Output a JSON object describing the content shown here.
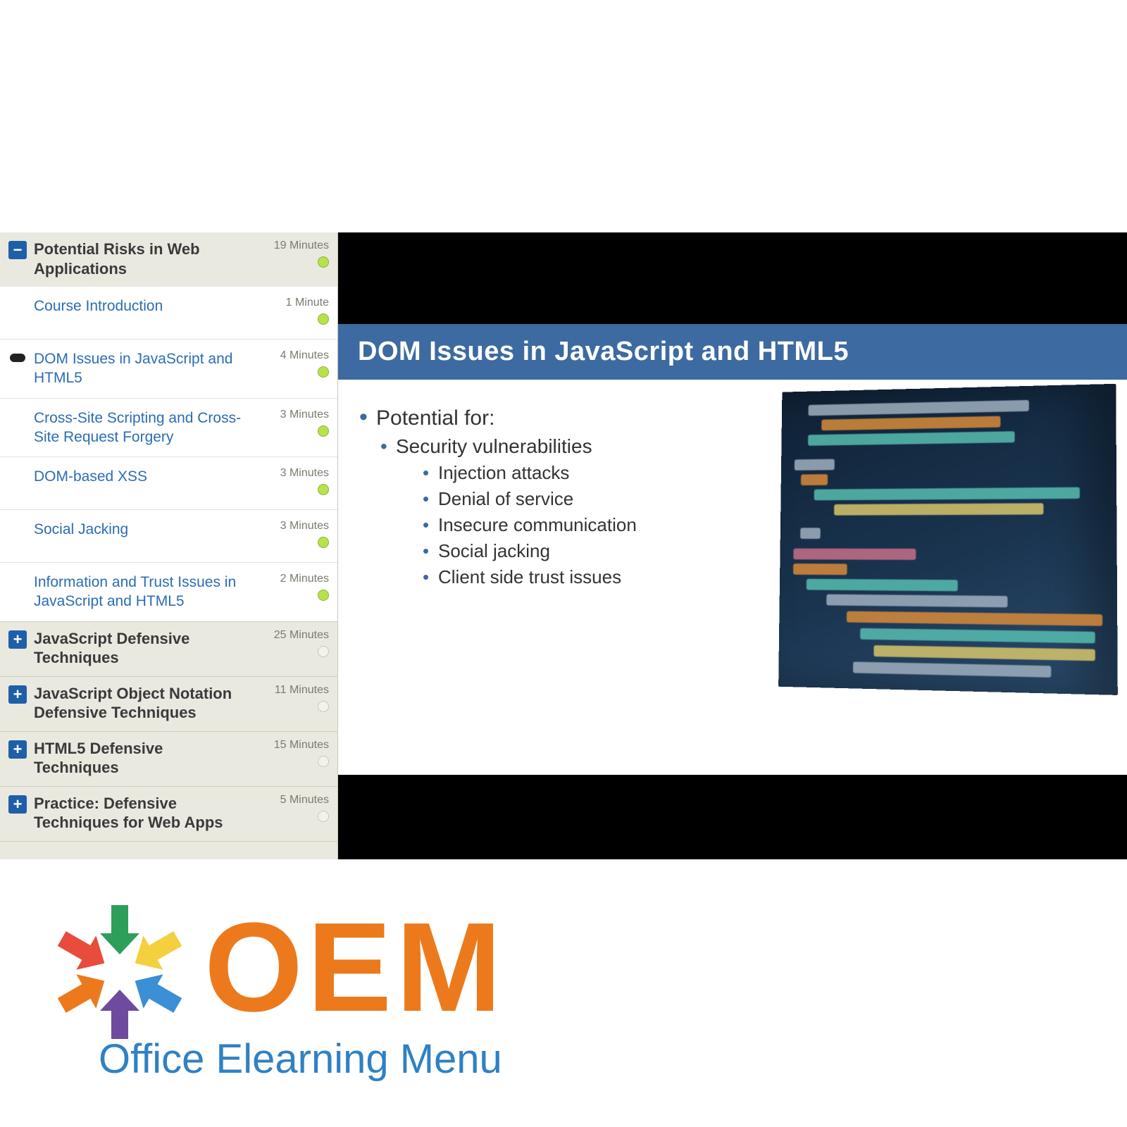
{
  "sidebar": {
    "sections": [
      {
        "title": "Potential Risks in Web Applications",
        "duration": "19 Minutes",
        "expanded": true,
        "status": "complete",
        "lessons": [
          {
            "title": "Course Introduction",
            "duration": "1 Minute",
            "status": "complete",
            "current": false
          },
          {
            "title": "DOM Issues in JavaScript and HTML5",
            "duration": "4 Minutes",
            "status": "complete",
            "current": true
          },
          {
            "title": "Cross-Site Scripting and Cross-Site Request Forgery",
            "duration": "3 Minutes",
            "status": "complete",
            "current": false
          },
          {
            "title": "DOM-based XSS",
            "duration": "3 Minutes",
            "status": "complete",
            "current": false
          },
          {
            "title": "Social Jacking",
            "duration": "3 Minutes",
            "status": "complete",
            "current": false
          },
          {
            "title": "Information and Trust Issues in JavaScript and HTML5",
            "duration": "2 Minutes",
            "status": "complete",
            "current": false
          }
        ]
      },
      {
        "title": "JavaScript Defensive Techniques",
        "duration": "25 Minutes",
        "expanded": false,
        "status": "pending"
      },
      {
        "title": "JavaScript Object Notation Defensive Techniques",
        "duration": "11 Minutes",
        "expanded": false,
        "status": "pending"
      },
      {
        "title": "HTML5 Defensive Techniques",
        "duration": "15 Minutes",
        "expanded": false,
        "status": "pending"
      },
      {
        "title": "Practice: Defensive Techniques for Web Apps",
        "duration": "5 Minutes",
        "expanded": false,
        "status": "pending"
      }
    ]
  },
  "slide": {
    "title": "DOM Issues in JavaScript and HTML5",
    "bullets": {
      "l1": "Potential for:",
      "l2": "Security vulnerabilities",
      "l3": [
        "Injection attacks",
        "Denial of service",
        "Insecure communication",
        "Social jacking",
        "Client side trust issues"
      ]
    }
  },
  "logo": {
    "main": "OEM",
    "sub": "Office Elearning Menu"
  },
  "icons": {
    "minus": "−",
    "plus": "+"
  }
}
